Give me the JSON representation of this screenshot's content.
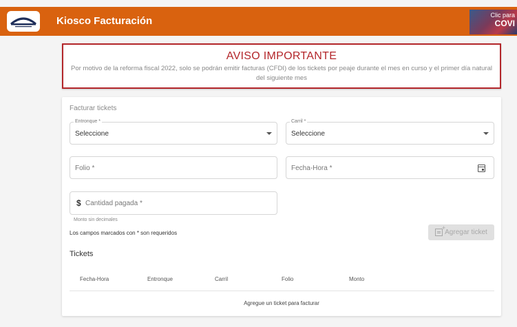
{
  "header": {
    "title": "Kiosco Facturación",
    "banner_line1": "Clic para",
    "banner_line2": "COVI",
    "bg_color": "#d9620f"
  },
  "notice": {
    "title": "AVISO IMPORTANTE",
    "body": "Por motivo de la reforma fiscal 2022, solo se podrán emitir facturas (CFDI) de los tickets por peaje durante el mes en curso y el primer día natural del siguiente mes",
    "border_color": "#b3262a"
  },
  "form": {
    "section_title": "Facturar tickets",
    "entronque": {
      "label": "Entronque *",
      "value": "Seleccione"
    },
    "carril": {
      "label": "Carril *",
      "value": "Seleccione"
    },
    "folio": {
      "placeholder": "Folio *"
    },
    "fecha_hora": {
      "placeholder": "Fecha-Hora *"
    },
    "cantidad": {
      "placeholder": "Cantidad pagada *",
      "hint": "Monto sin decimales"
    },
    "required_note": "Los campos marcados con * son requeridos",
    "add_button": "Agregar ticket"
  },
  "tickets": {
    "title": "Tickets",
    "columns": [
      "Fecha-Hora",
      "Entronque",
      "Carril",
      "Folio",
      "Monto"
    ],
    "empty_message": "Agregue un ticket para facturar"
  }
}
